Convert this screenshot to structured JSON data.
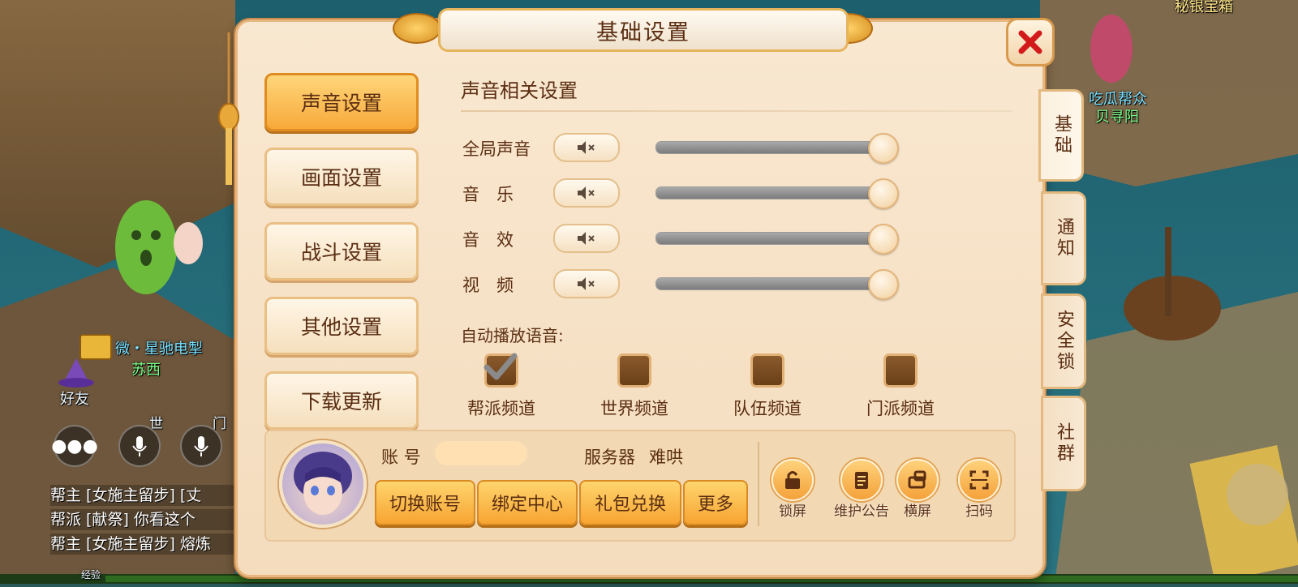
{
  "dialog": {
    "title": "基础设置",
    "close_label": "✕"
  },
  "left_menu": [
    {
      "label": "声音设置",
      "active": true
    },
    {
      "label": "画面设置",
      "active": false
    },
    {
      "label": "战斗设置",
      "active": false
    },
    {
      "label": "其他设置",
      "active": false
    },
    {
      "label": "下载更新",
      "active": false
    }
  ],
  "sound": {
    "section_title": "声音相关设置",
    "rows": [
      {
        "label": "全局声音",
        "muted_icon": "speaker-mute-icon",
        "level": 1.0
      },
      {
        "label": "音　乐",
        "muted_icon": "speaker-mute-icon",
        "level": 1.0
      },
      {
        "label": "音　效",
        "muted_icon": "speaker-mute-icon",
        "level": 1.0
      },
      {
        "label": "视　频",
        "muted_icon": "speaker-mute-icon",
        "level": 1.0
      }
    ],
    "auto_voice_label": "自动播放语音:",
    "channels": [
      {
        "label": "帮派频道",
        "checked": true
      },
      {
        "label": "世界频道",
        "checked": false
      },
      {
        "label": "队伍频道",
        "checked": false
      },
      {
        "label": "门派频道",
        "checked": false
      }
    ]
  },
  "account": {
    "account_label": "账 号",
    "account_value": "",
    "server_label": "服务器",
    "server_value": "难哄",
    "buttons": [
      "切换账号",
      "绑定中心",
      "礼包兑换",
      "更多"
    ],
    "tools": [
      {
        "label": "锁屏",
        "icon": "lock-icon"
      },
      {
        "label": "维护公告",
        "icon": "notice-board-icon"
      },
      {
        "label": "横屏",
        "icon": "rotate-screen-icon"
      },
      {
        "label": "扫码",
        "icon": "scan-qr-icon"
      }
    ]
  },
  "side_tabs": [
    {
      "label": "基础",
      "active": true
    },
    {
      "label": "通知",
      "active": false
    },
    {
      "label": "安全锁",
      "active": false
    },
    {
      "label": "社群",
      "active": false
    }
  ],
  "background": {
    "npc_top_right_title": "秘银宝箱",
    "npc_top_right_guild": "吃瓜帮众",
    "npc_top_right_name": "贝寻阳",
    "player_title": "微・星驰电掣",
    "player_name": "苏西",
    "friends_label": "好友",
    "voice_world": "世",
    "voice_sect": "门",
    "exp_label": "经验",
    "chat": [
      "帮主 [女施主留步] [丈",
      "帮派 [献祭] 你看这个",
      "帮主 [女施主留步] 熔炼"
    ],
    "colors": {
      "accent": "#f7a93a",
      "panel": "#f9e8d1",
      "border": "#e8b780",
      "text": "#5b2e12"
    }
  }
}
